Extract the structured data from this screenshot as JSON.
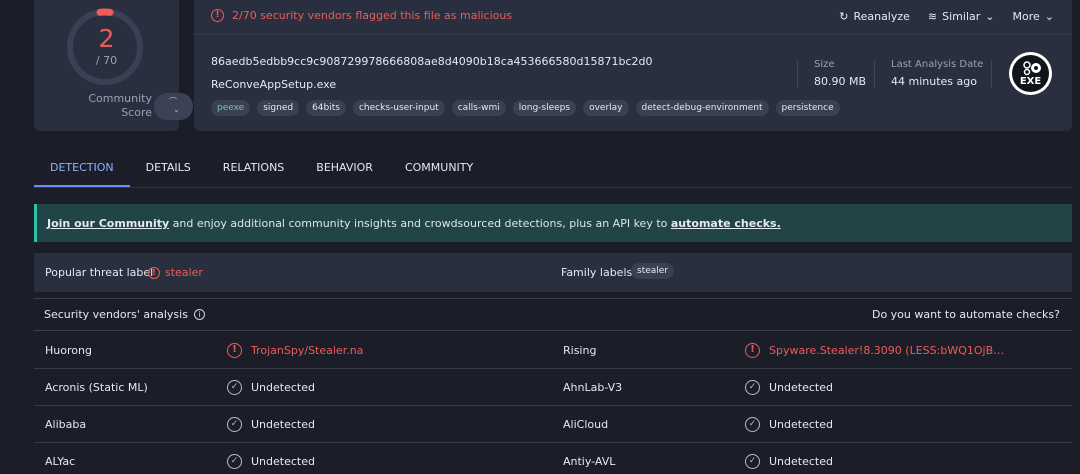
{
  "score": {
    "detections": "2",
    "total": "/ 70",
    "community_label_1": "Community",
    "community_label_2": "Score"
  },
  "banner": {
    "message": "2/70 security vendors flagged this file as malicious"
  },
  "actions": {
    "reanalyze": "Reanalyze",
    "similar": "Similar",
    "more": "More"
  },
  "file": {
    "hash": "86aedb5edbb9cc9c908729978666808ae8d4090b18ca453666580d15871bc2d0",
    "name": "ReConveAppSetup.exe",
    "tags": [
      "peexe",
      "signed",
      "64bits",
      "checks-user-input",
      "calls-wmi",
      "long-sleeps",
      "overlay",
      "detect-debug-environment",
      "persistence"
    ],
    "size_label": "Size",
    "size_value": "80.90 MB",
    "last_label": "Last Analysis Date",
    "last_value": "44 minutes ago",
    "type_icon_text": "EXE"
  },
  "tabs": [
    "DETECTION",
    "DETAILS",
    "RELATIONS",
    "BEHAVIOR",
    "COMMUNITY"
  ],
  "community_banner": {
    "link1": "Join our Community",
    "middle": " and enjoy additional community insights and crowdsourced detections, plus an API key to ",
    "link2": "automate checks."
  },
  "threat": {
    "popular_label": "Popular threat label",
    "popular_value": "stealer",
    "family_label": "Family labels",
    "family_value": "stealer"
  },
  "vendors": {
    "title": "Security vendors' analysis",
    "automate": "Do you want to automate checks?",
    "rows": [
      {
        "left_name": "Huorong",
        "left_result": "TrojanSpy/Stealer.na",
        "left_detected": true,
        "right_name": "Rising",
        "right_result": "Spyware.Stealer!8.3090 (LESS:bWQ1OjB…",
        "right_detected": true
      },
      {
        "left_name": "Acronis (Static ML)",
        "left_result": "Undetected",
        "left_detected": false,
        "right_name": "AhnLab-V3",
        "right_result": "Undetected",
        "right_detected": false
      },
      {
        "left_name": "Alibaba",
        "left_result": "Undetected",
        "left_detected": false,
        "right_name": "AliCloud",
        "right_result": "Undetected",
        "right_detected": false
      },
      {
        "left_name": "ALYac",
        "left_result": "Undetected",
        "left_detected": false,
        "right_name": "Antiy-AVL",
        "right_result": "Undetected",
        "right_detected": false
      }
    ]
  }
}
